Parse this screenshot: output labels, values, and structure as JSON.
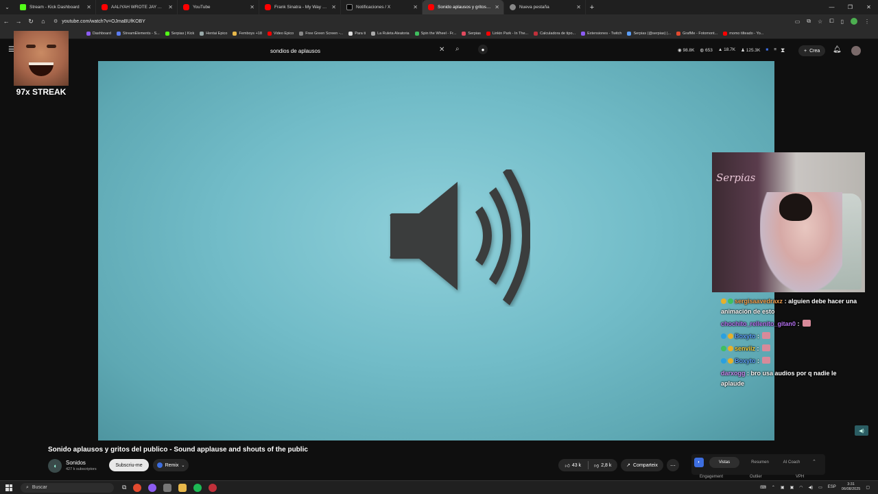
{
  "browser": {
    "tabs": [
      {
        "label": "Stream - Kick Dashboard",
        "icon": "kick-icon",
        "active": false
      },
      {
        "label": "AALIYAH WROTE JAY AN APOL",
        "icon": "youtube-icon",
        "active": false
      },
      {
        "label": "YouTube",
        "icon": "youtube-icon",
        "active": false
      },
      {
        "label": "Frank Sinatra - My Way (Karao",
        "icon": "youtube-icon",
        "active": false
      },
      {
        "label": "Notificaciones / X",
        "icon": "x-icon",
        "active": false
      },
      {
        "label": "Sonido aplausos y gritos de",
        "icon": "youtube-icon",
        "active": true
      },
      {
        "label": "Nueva pestaña",
        "icon": "globe-icon",
        "active": false
      }
    ],
    "url": "youtube.com/watch?v=OJmaBUfKOBY",
    "bookmarks": [
      "Dashboard",
      "StreamElements - S...",
      "Serpias | Kick",
      "Hentai Epico",
      "Femboys +18",
      "Video Epico",
      "Free Green Screen -...",
      "Para ti",
      "La Ruleta Aleatoria",
      "Spin the Wheel - Fr...",
      "Serpias",
      "Linkin Park - In The...",
      "Calculadora de tipo...",
      "Extensiones - Twitch",
      "Serpias (@serpias) |...",
      "GrafMe - Fotomont...",
      "momo tilteado - Yo..."
    ]
  },
  "youtube": {
    "search_query": "sondios de aplausos",
    "header_stats": [
      "98.8K",
      "653",
      "18.7K",
      "125.3K"
    ],
    "create_label": "Crea",
    "video_title": "Sonido aplausos y gritos del publico - Sound applause and shouts of the public",
    "channel_name": "Sonidos",
    "channel_subs": "427 k subscriptors",
    "subscribe_label": "Subscriu-me",
    "remix_label": "Remix",
    "likes": "43 k",
    "dislikes": "2,8 k",
    "share_label": "Comparteix",
    "extension": {
      "tabs": [
        "Vistas",
        "Resumen",
        "AI Coach"
      ],
      "subtabs": [
        "Engagement",
        "Outlier",
        "VPH"
      ]
    }
  },
  "overlay": {
    "streak_label": "97x STREAK",
    "webcam_brand": "Serpias",
    "chat": [
      {
        "user": "sergisaavedraxz",
        "text": ": alguien debe hacer una animación de esto",
        "user_color": "#f0a050",
        "badges": [
          "gold",
          "green"
        ]
      },
      {
        "user": "chochito_rellenito_gitan0",
        "text": ":",
        "user_color": "#b470f0",
        "badges": [],
        "emote": true
      },
      {
        "user": "Boxyto",
        "text": ":",
        "user_color": "#5b9ef8",
        "badges": [
          "blue",
          "gold"
        ],
        "emote": true
      },
      {
        "user": "senviiz",
        "text": ":",
        "user_color": "#f4d03f",
        "badges": [
          "green",
          "gold"
        ],
        "emote": true
      },
      {
        "user": "Boxyto",
        "text": ":",
        "user_color": "#5b9ef8",
        "badges": [
          "blue",
          "gold"
        ],
        "emote": true
      },
      {
        "user": "darxogg",
        "text": ": bro usa audios por q nadie le aplaude",
        "user_color": "#c78df2",
        "badges": [],
        "emote": false
      }
    ]
  },
  "taskbar": {
    "search_placeholder": "Buscar",
    "lang": "ESP",
    "time": "3:31",
    "date": "06/08/2025"
  }
}
